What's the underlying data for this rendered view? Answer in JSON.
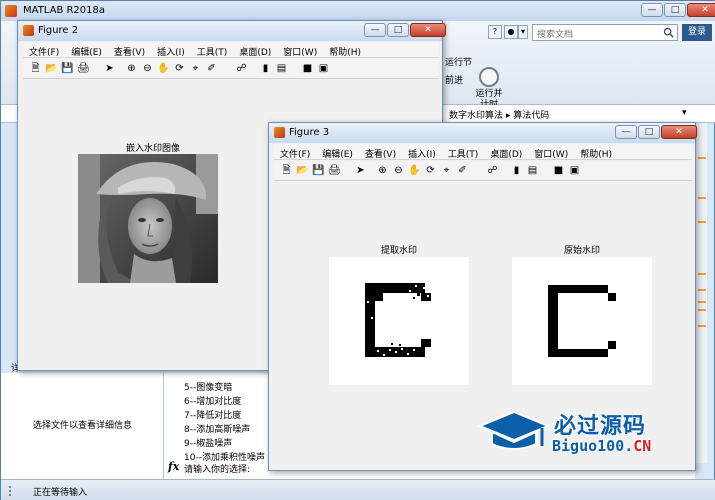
{
  "main": {
    "title": "MATLAB R2018a",
    "search_placeholder": "搜索文档",
    "login": "登录",
    "ribbon": {
      "run_section": "运行节",
      "advance": "前进",
      "run_time_line1": "运行并",
      "run_time_line2": "计时"
    },
    "path": {
      "crumbs": "数字水印算法 ▸ 算法代码"
    },
    "left_panel": {
      "tag": "详",
      "message": "选择文件以查看详细信息"
    },
    "command_window": {
      "lines": [
        "5--图像变暗",
        "6--增加对比度",
        "7--降低对比度",
        "8--添加高斯噪声",
        "9--椒盐噪声",
        "10--添加乘积性噪声"
      ],
      "prompt": "请输入你的选择:"
    },
    "status": "正在等待输入"
  },
  "fig2": {
    "title": "Figure 2",
    "menu": [
      "文件(F)",
      "编辑(E)",
      "查看(V)",
      "插入(I)",
      "工具(T)",
      "桌面(D)",
      "窗口(W)",
      "帮助(H)"
    ],
    "axes_title": "嵌入水印图像"
  },
  "fig3": {
    "title": "Figure 3",
    "menu": [
      "文件(F)",
      "编辑(E)",
      "查看(V)",
      "插入(I)",
      "工具(T)",
      "桌面(D)",
      "窗口(W)",
      "帮助(H)"
    ],
    "axes1_title": "提取水印",
    "axes2_title": "原始水印"
  },
  "brand": {
    "cn": "必过源码",
    "en_prefix": "Biguo100.",
    "en_suffix": "CN"
  },
  "icons": {
    "new": "new-file-icon",
    "open": "open-folder-icon",
    "save": "save-icon",
    "print": "print-icon",
    "pointer": "pointer-icon",
    "zoom_in": "zoom-in-icon",
    "zoom_out": "zoom-out-icon",
    "pan": "pan-icon",
    "rotate": "rotate-3d-icon",
    "datacursor": "data-cursor-icon",
    "brush": "brush-icon",
    "link": "link-plot-icon",
    "colorbar": "colorbar-icon",
    "legend": "legend-icon",
    "hide": "hide-plot-tools-icon",
    "show": "show-plot-tools-icon"
  }
}
